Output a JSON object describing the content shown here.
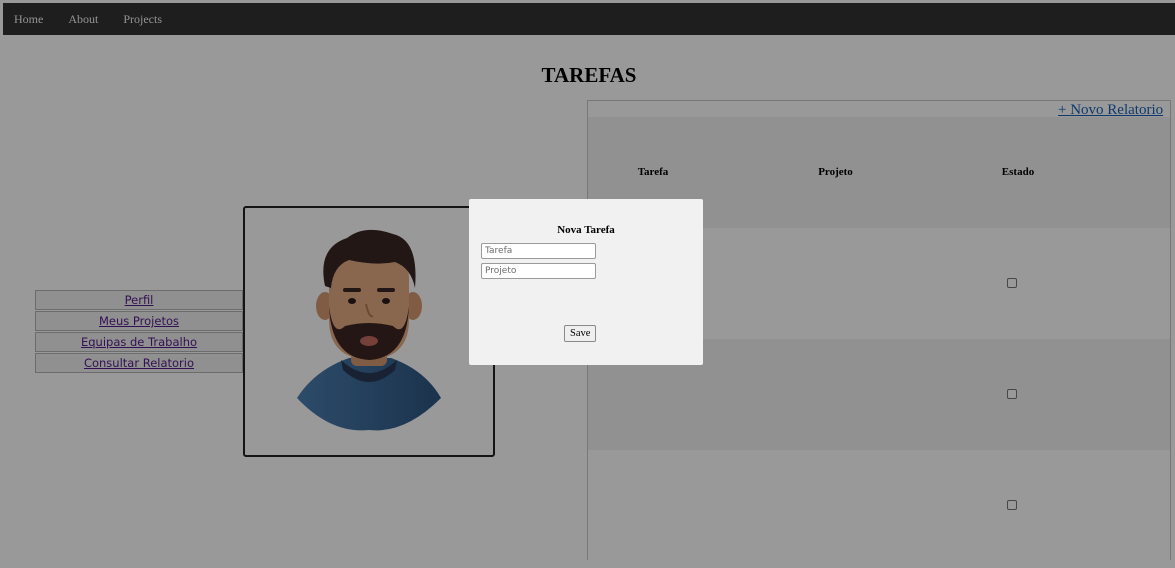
{
  "nav": {
    "links": [
      "Home",
      "About",
      "Projects"
    ]
  },
  "page": {
    "title": "TAREFAS",
    "new_report_label": "+ Novo Relatorio"
  },
  "side_menu": {
    "items": [
      "Perfil",
      "Meus Projetos",
      "Equipas de Trabalho",
      "Consultar Relatorio"
    ]
  },
  "table": {
    "headers": [
      "Tarefa",
      "Projeto",
      "Estado"
    ],
    "rows": [
      {
        "tarefa": "",
        "projeto": "",
        "estado_checked": false
      },
      {
        "tarefa": "",
        "projeto": "",
        "estado_checked": false
      },
      {
        "tarefa": "",
        "projeto": "",
        "estado_checked": false
      }
    ]
  },
  "modal": {
    "title": "Nova Tarefa",
    "tarefa_placeholder": "Tarefa",
    "projeto_placeholder": "Projeto",
    "save_label": "Save"
  },
  "colors": {
    "navbar": "#333333",
    "overlay": "rgba(0,0,0,0.4)",
    "link_visited": "#551a8b",
    "link": "#1a5fb4",
    "modal_bg": "#f1f1f1"
  },
  "icons": [
    "avatar-illustration",
    "checkbox-icon"
  ]
}
